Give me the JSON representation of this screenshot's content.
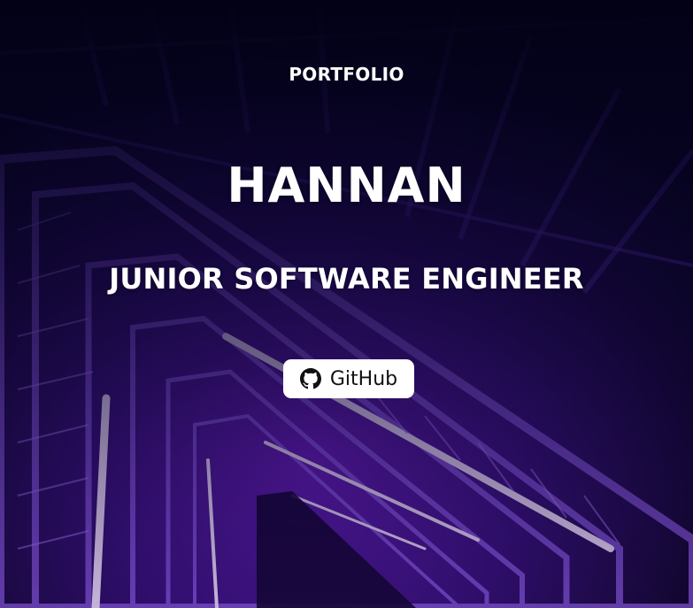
{
  "hero": {
    "eyebrow": "PORTFOLIO",
    "name": "HANNAN",
    "role": "JUNIOR SOFTWARE ENGINEER",
    "github_label": "GitHub",
    "github_icon": "github-icon"
  },
  "colors": {
    "background_dark": "#07041a",
    "accent_purple": "#8a2be2",
    "neon_light": "#c89bff",
    "button_bg": "#ffffff",
    "button_text": "#111111"
  }
}
